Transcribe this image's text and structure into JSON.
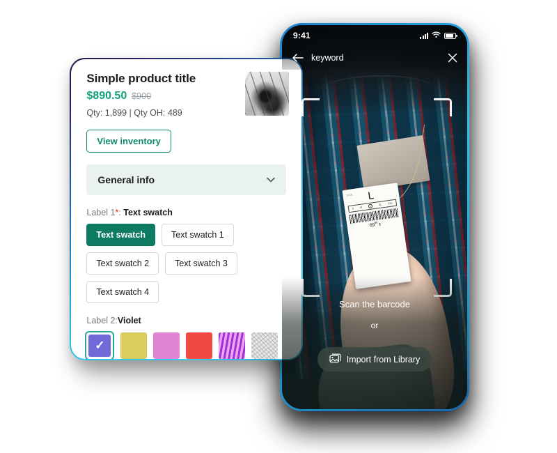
{
  "phone": {
    "status_bar": {
      "time": "9:41",
      "signal_icon": "signal-bars-icon",
      "wifi_icon": "wifi-icon",
      "battery_icon": "battery-icon"
    },
    "search_bar": {
      "back_icon": "back-arrow-icon",
      "keyword": "keyword",
      "close_icon": "close-icon"
    },
    "scanner": {
      "hint": "Scan the barcode",
      "or": "or",
      "import_button": "Import from Library",
      "import_icon": "photo-library-icon"
    },
    "tag": {
      "size_label": "SIZE",
      "size_value": "L",
      "sizes": [
        "S",
        "M",
        "L",
        "XL",
        "XXL"
      ],
      "selected_size": "L",
      "price": "69",
      "price_cents": "99",
      "currency": "$"
    }
  },
  "card": {
    "title": "Simple product title",
    "price": "$890.50",
    "price_compare": "$900",
    "qty": "Qty: 1,899 | Qty OH: 489",
    "thumbnail_name": "product-thumbnail",
    "view_inventory": "View inventory",
    "accordion": {
      "label": "General info",
      "chevron_icon": "chevron-down-icon"
    },
    "option1": {
      "label": "Label 1",
      "required_mark": "*",
      "separator": ": ",
      "value": "Text swatch",
      "chips": [
        {
          "label": "Text swatch",
          "selected": true
        },
        {
          "label": "Text swatch 1",
          "selected": false
        },
        {
          "label": "Text swatch 2",
          "selected": false
        },
        {
          "label": "Text swatch 3",
          "selected": false
        },
        {
          "label": "Text swatch 4",
          "selected": false
        }
      ]
    },
    "option2": {
      "label": "Label 2",
      "separator": ":",
      "value": "Violet",
      "swatches": [
        {
          "name": "violet",
          "color": "#6f6ad8",
          "selected": true,
          "type": "color",
          "check": "✓"
        },
        {
          "name": "yellow",
          "color": "#d9cd5e",
          "selected": false,
          "type": "color"
        },
        {
          "name": "orchid",
          "color": "#df85d3",
          "selected": false,
          "type": "color"
        },
        {
          "name": "red",
          "color": "#ee4a43",
          "selected": false,
          "type": "color"
        },
        {
          "name": "purple-pattern",
          "color": "#a93be0",
          "selected": false,
          "type": "pattern"
        },
        {
          "name": "grey-texture",
          "color": "#e3e3e3",
          "selected": false,
          "type": "pattern"
        }
      ]
    }
  },
  "colors": {
    "accent_teal": "#0d7a63",
    "price_green": "#11a27a",
    "required_red": "#e02424",
    "swatch_ring": "#2aa79a",
    "accordion_bg": "#e9f2ed",
    "phone_frame": "#2ec3ea"
  }
}
